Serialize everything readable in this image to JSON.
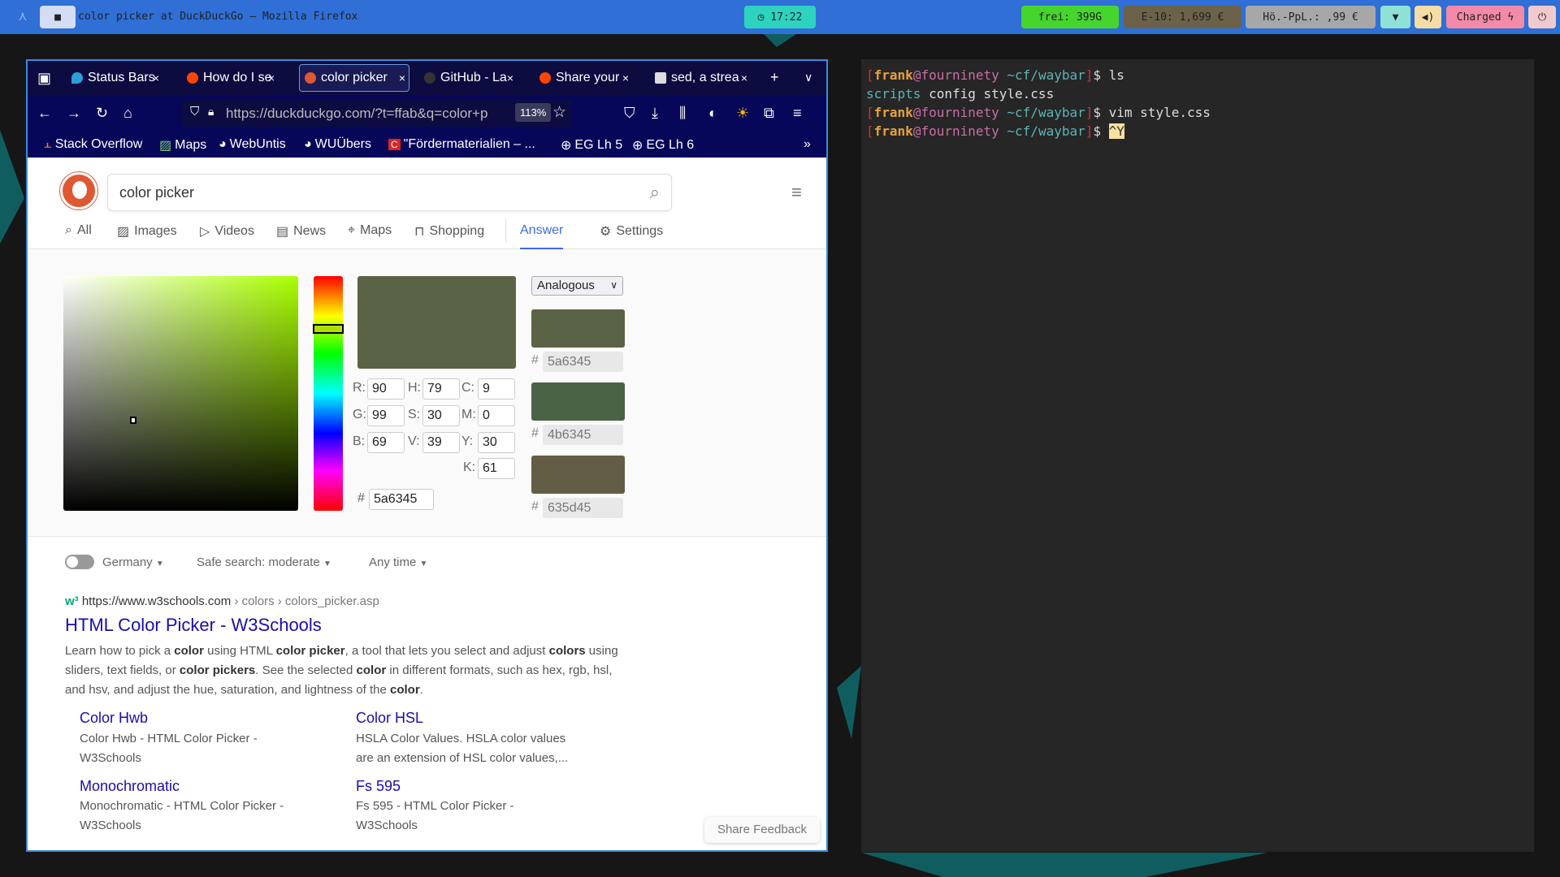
{
  "topbar": {
    "window_title": "color picker at DuckDuckGo — Mozilla Firefox",
    "clock": "17:22",
    "disk": "frei: 399G",
    "fuel_e10": "E-10: 1,699 €",
    "fuel_hoe": "Hö.-PpL.: ,99 €",
    "battery": "Charged ϟ",
    "colors": {
      "bar": "#2f6fd6",
      "clock": "#2ed3c0",
      "disk": "#45d52d",
      "e10": "#6b6249",
      "hoe": "#a7a7a7",
      "battery": "#f28aa8"
    }
  },
  "browser": {
    "tabs": [
      {
        "label": "Status Bars"
      },
      {
        "label": "How do I se"
      },
      {
        "label": "color picker",
        "active": true
      },
      {
        "label": "GitHub - La"
      },
      {
        "label": "Share your"
      },
      {
        "label": "sed, a strea"
      }
    ],
    "url": "https://duckduckgo.com/?t=ffab&q=color+p",
    "zoom": "113%",
    "bookmarks": [
      "Stack Overflow",
      "Maps",
      "WebUntis",
      "WUÜbers",
      "\"Fördermaterialien – ...",
      "EG Lh 5",
      "EG Lh 6"
    ]
  },
  "ddg": {
    "search_value": "color picker",
    "nav": [
      {
        "label": "All",
        "icon": "search-icon"
      },
      {
        "label": "Images",
        "icon": "image-icon"
      },
      {
        "label": "Videos",
        "icon": "play-icon"
      },
      {
        "label": "News",
        "icon": "news-icon"
      },
      {
        "label": "Maps",
        "icon": "pin-icon"
      },
      {
        "label": "Shopping",
        "icon": "bag-icon"
      },
      {
        "label": "Answer",
        "active": true
      },
      {
        "label": "Settings",
        "icon": "settings-icon"
      }
    ],
    "picker": {
      "hue": 79,
      "saturation": 30,
      "value": 39,
      "fields": {
        "R": "90",
        "G": "99",
        "B": "69",
        "H": "79",
        "S": "30",
        "V": "39",
        "C": "9",
        "M": "0",
        "Y": "30",
        "K": "61"
      },
      "hex": "5a6345",
      "mode": "Analogous",
      "swatches": [
        "5a6345",
        "4b6345",
        "635d45"
      ]
    },
    "filters": {
      "region": "Germany",
      "safe": "Safe search: moderate",
      "time": "Any time"
    },
    "result": {
      "url": "https://www.w3schools.com",
      "path": " › colors › colors_picker.asp",
      "title": "HTML Color Picker - W3Schools",
      "snippet": [
        "Learn how to pick a <b>color</b> using HTML <b>color picker</b>, a tool that lets you select and adjust <b>colors</b> using",
        "sliders, text fields, or <b>color pickers</b>. See the selected <b>color</b> in different formats, such as hex, rgb, hsl,",
        "and hsv, and adjust the hue, saturation, and lightness of the <b>color</b>."
      ],
      "sublinks": [
        {
          "title": "Color Hwb",
          "desc": [
            "Color Hwb - HTML Color Picker -",
            "W3Schools"
          ]
        },
        {
          "title": "Color HSL",
          "desc": [
            "HSLA Color Values. HSLA color values",
            "are an extension of HSL color values,..."
          ]
        },
        {
          "title": "Monochromatic",
          "desc": [
            "Monochromatic - HTML Color Picker -",
            "W3Schools"
          ]
        },
        {
          "title": "Fs 595",
          "desc": [
            "Fs 595 - HTML Color Picker -",
            "W3Schools"
          ]
        }
      ]
    },
    "feedback": "Share Feedback"
  },
  "terminal": {
    "user": "frank",
    "host": "fourninety",
    "cwd": "~cf/waybar",
    "lines": [
      {
        "cmd": "ls"
      },
      {
        "output": [
          "scripts",
          "config",
          "style.css"
        ]
      },
      {
        "cmd": "vim style.css"
      },
      {
        "cmd": "^Y"
      }
    ]
  }
}
